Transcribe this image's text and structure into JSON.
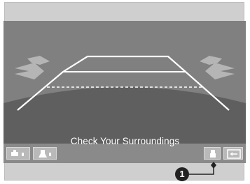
{
  "screen": {
    "status_message": "Check Your Surroundings"
  },
  "camera_controls": {
    "left_buttons": [
      {
        "icon": "camera-view-normal-icon"
      },
      {
        "icon": "camera-view-top-icon"
      }
    ],
    "right_buttons": [
      {
        "icon": "camera-view-wide-icon"
      },
      {
        "icon": "exit-icon"
      }
    ]
  },
  "callout": {
    "number": "1"
  },
  "colors": {
    "guideline": "#ffffff",
    "arrows": "#b0b0b0",
    "bottom_bar": "#8a8a8a"
  }
}
